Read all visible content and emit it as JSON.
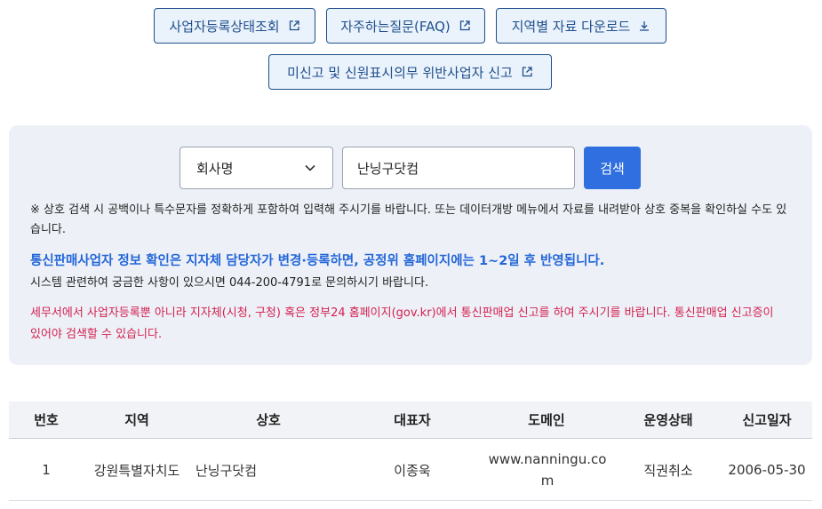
{
  "links": [
    {
      "label": "사업자등록상태조회",
      "icon": "external-link-icon"
    },
    {
      "label": "자주하는질문(FAQ)",
      "icon": "external-link-icon"
    },
    {
      "label": "지역별 자료 다운로드",
      "icon": "download-icon"
    },
    {
      "label": "미신고 및 신원표시의무 위반사업자 신고",
      "icon": "external-link-icon"
    }
  ],
  "search": {
    "select_value": "회사명",
    "input_value": "난닝구닷컴",
    "button_label": "검색"
  },
  "notes": {
    "info": "※ 상호 검색 시 공백이나 특수문자를 정확하게 포함하여 입력해 주시기를 바랍니다. 또는 데이터개방 메뉴에서 자료를 내려받아 상호 중복을 확인하실 수도 있습니다.",
    "highlight": "통신판매사업자 정보 확인은 지자체 담당자가 변경·등록하면, 공정위 홈페이지에는 1~2일 후 반영됩니다.",
    "contact": "시스템 관련하여 궁금한 사항이 있으시면 044-200-4791로 문의하시기 바랍니다.",
    "warning": "세무서에서 사업자등록뿐 아니라 지자체(시청, 구청) 혹은 정부24 홈페이지(gov.kr)에서 통신판매업 신고를 하여 주시기를 바랍니다. 통신판매업 신고증이 있어야 검색할 수 있습니다."
  },
  "table": {
    "headers": {
      "no": "번호",
      "region": "지역",
      "company": "상호",
      "ceo": "대표자",
      "domain": "도메인",
      "status": "운영상태",
      "date": "신고일자"
    },
    "rows": [
      {
        "no": "1",
        "region": "강원특별자치도",
        "company": "난닝구닷컴",
        "ceo": "이종욱",
        "domain": "www.nanningu.com",
        "status": "직권취소",
        "date": "2006-05-30"
      }
    ]
  },
  "colors": {
    "accent": "#2f6fe0",
    "link_border": "#1f4f8c",
    "warning": "#d4204f",
    "highlight": "#2466d8"
  }
}
